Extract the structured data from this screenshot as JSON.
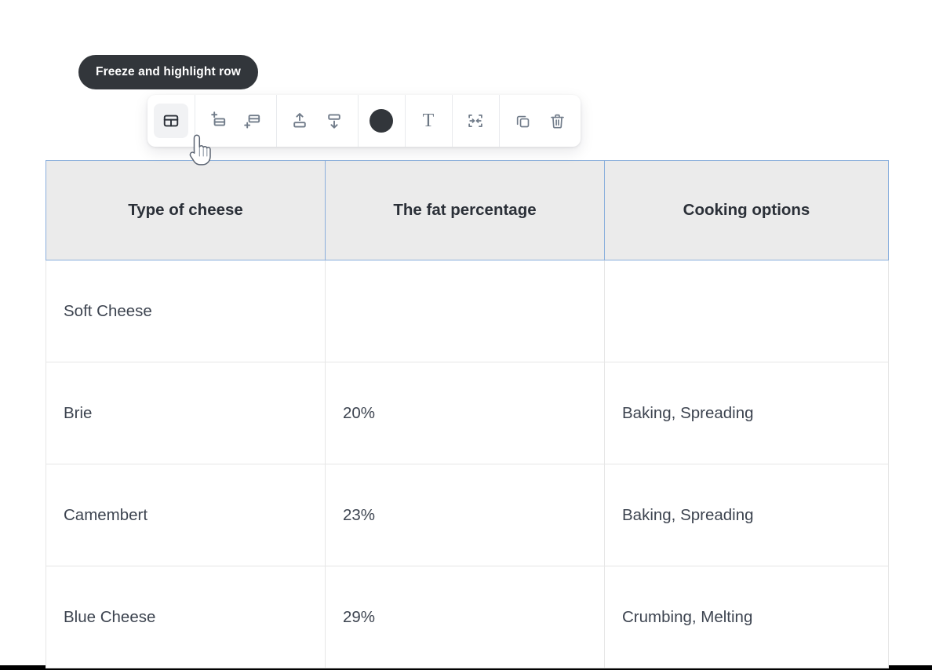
{
  "tooltip": {
    "text": "Freeze and highlight row",
    "background_color": "#32363b",
    "text_color": "#ffffff"
  },
  "toolbar": {
    "groups": [
      {
        "name": "freeze-group",
        "buttons": [
          {
            "icon": "table-grid-icon",
            "label": "Freeze and highlight row",
            "active": true
          }
        ]
      },
      {
        "name": "insert-row-group",
        "buttons": [
          {
            "icon": "insert-row-above-icon",
            "label": "Insert row above",
            "active": false
          },
          {
            "icon": "insert-row-below-icon",
            "label": "Insert row below",
            "active": false
          }
        ]
      },
      {
        "name": "move-row-group",
        "buttons": [
          {
            "icon": "move-row-up-icon",
            "label": "Move row up",
            "active": false
          },
          {
            "icon": "move-row-down-icon",
            "label": "Move row down",
            "active": false
          }
        ]
      },
      {
        "name": "color-group",
        "buttons": [
          {
            "icon": "color-swatch-icon",
            "label": "Cell color",
            "active": false,
            "color": "#32363b"
          }
        ]
      },
      {
        "name": "text-group",
        "buttons": [
          {
            "icon": "text-format-icon",
            "label": "Text formatting",
            "active": false
          }
        ]
      },
      {
        "name": "merge-group",
        "buttons": [
          {
            "icon": "merge-cells-icon",
            "label": "Merge cells",
            "active": false
          }
        ]
      },
      {
        "name": "actions-group",
        "buttons": [
          {
            "icon": "duplicate-icon",
            "label": "Duplicate",
            "active": false
          },
          {
            "icon": "trash-icon",
            "label": "Delete",
            "active": false
          }
        ]
      }
    ]
  },
  "cursor": {
    "icon": "pointing-hand-cursor"
  },
  "table": {
    "header_background": "#ebebeb",
    "header_border_color": "#8aafdc",
    "body_border_color": "#e6e6e6",
    "columns": [
      "Type of cheese",
      "The fat percentage",
      "Cooking options"
    ],
    "rows": [
      [
        "Soft Cheese",
        "",
        ""
      ],
      [
        "Brie",
        "20%",
        "Baking, Spreading"
      ],
      [
        "Camembert",
        "23%",
        "Baking, Spreading"
      ],
      [
        "Blue Cheese",
        "29%",
        "Crumbing, Melting"
      ]
    ]
  }
}
